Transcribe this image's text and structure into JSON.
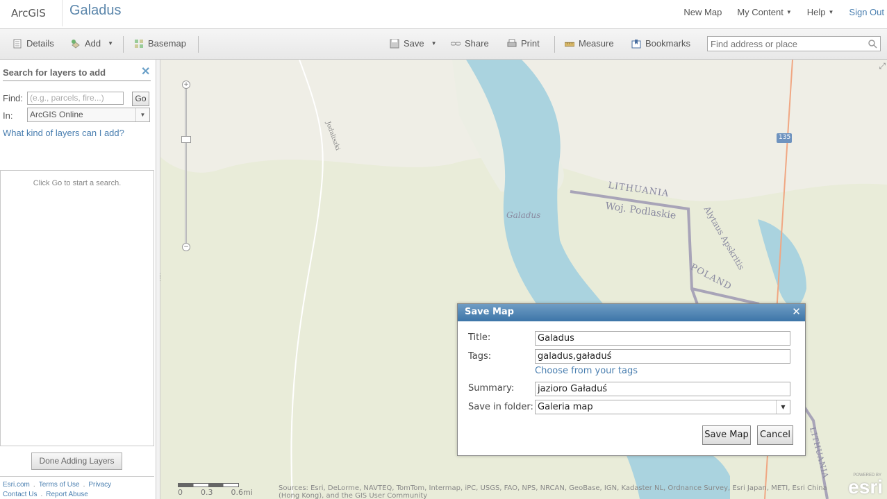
{
  "header": {
    "logo": "ArcGIS",
    "map_title": "Galadus",
    "nav": [
      "New Map",
      "My Content",
      "Help",
      "Sign Out"
    ]
  },
  "toolbar": {
    "details": "Details",
    "add": "Add",
    "basemap": "Basemap",
    "save": "Save",
    "share": "Share",
    "print": "Print",
    "measure": "Measure",
    "bookmarks": "Bookmarks",
    "search_placeholder": "Find address or place"
  },
  "left_panel": {
    "title": "Search for layers to add",
    "find_label": "Find:",
    "find_placeholder": "(e.g., parcels, fire...)",
    "go_label": "Go",
    "in_label": "In:",
    "in_value": "ArcGIS Online",
    "help_link": "What kind of layers can I add?",
    "results_hint": "Click Go to start a search.",
    "done_button": "Done Adding Layers",
    "footer": {
      "esri_com": "Esri.com",
      "terms": "Terms of Use",
      "privacy": "Privacy",
      "contact": "Contact Us",
      "report": "Report Abuse"
    }
  },
  "map": {
    "labels": {
      "lake": "Galadus",
      "road": "Jodaliszki",
      "country_lt": "LITHUANIA",
      "region_pl": "Woj. Podlaskie",
      "region_lt": "Alytaus Apskritis",
      "country_pl": "POLAND",
      "country_lt_2": "LITHUANIA",
      "route": "135"
    },
    "scale": {
      "zero": "0",
      "mid": "0.3",
      "end": "0.6mi"
    },
    "attribution": "Sources: Esri, DeLorme, NAVTEQ, TomTom, Intermap, iPC, USGS, FAO, NPS, NRCAN, GeoBase, IGN, Kadaster NL, Ordnance Survey, Esri Japan, METI, Esri China (Hong Kong), and the GIS User Community",
    "esri_powered": "POWERED BY",
    "esri_logo": "esri"
  },
  "dialog": {
    "title": "Save Map",
    "title_label": "Title:",
    "title_value": "Galadus",
    "tags_label": "Tags:",
    "tags_value": "galadus,gaładuś",
    "tags_link": "Choose from your tags",
    "summary_label": "Summary:",
    "summary_value": "jazioro Gaładuś",
    "folder_label": "Save in folder:",
    "folder_value": "Galeria map",
    "save_button": "Save Map",
    "cancel_button": "Cancel"
  }
}
